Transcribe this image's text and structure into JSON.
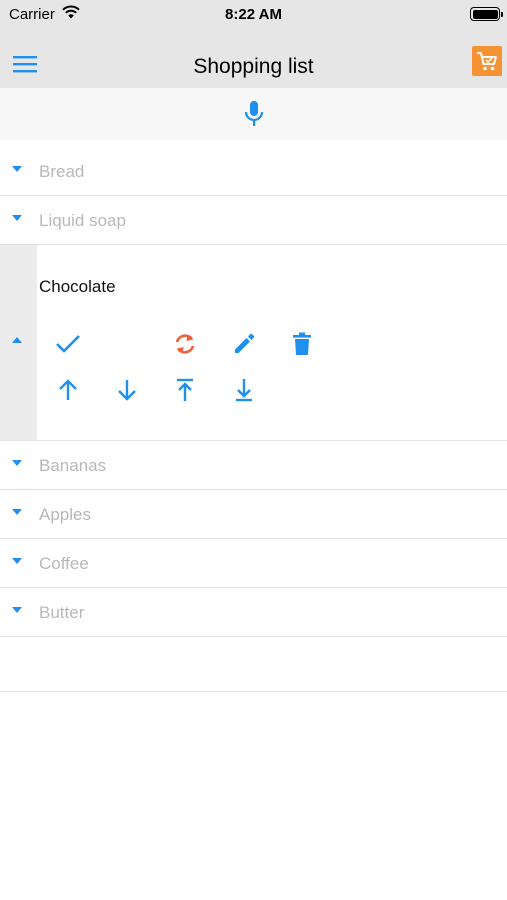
{
  "status_bar": {
    "carrier": "Carrier",
    "time": "8:22 AM"
  },
  "header": {
    "title": "Shopping list"
  },
  "items_before": [
    {
      "label": "Bread"
    },
    {
      "label": "Liquid soap"
    }
  ],
  "expanded_item": {
    "label": "Chocolate",
    "actions": [
      {
        "icon": "check-icon",
        "color": "#1f8ff0"
      },
      {
        "icon": "sync-icon",
        "color": "#f0603c"
      },
      {
        "icon": "pencil-icon",
        "color": "#1f8ff0"
      },
      {
        "icon": "trash-icon",
        "color": "#1f8ff0"
      },
      {
        "icon": "arrow-up-icon",
        "color": "#1f8ff0"
      },
      {
        "icon": "arrow-down-icon",
        "color": "#1f8ff0"
      },
      {
        "icon": "move-to-top-icon",
        "color": "#1f8ff0"
      },
      {
        "icon": "move-to-bottom-icon",
        "color": "#1f8ff0"
      }
    ]
  },
  "items_after": [
    {
      "label": "Bananas"
    },
    {
      "label": "Apples"
    },
    {
      "label": "Coffee"
    },
    {
      "label": "Butter"
    }
  ],
  "colors": {
    "accent": "#1f8ff0",
    "cart": "#f59333",
    "sync": "#f0603c",
    "bar": "#e6e6e6"
  }
}
